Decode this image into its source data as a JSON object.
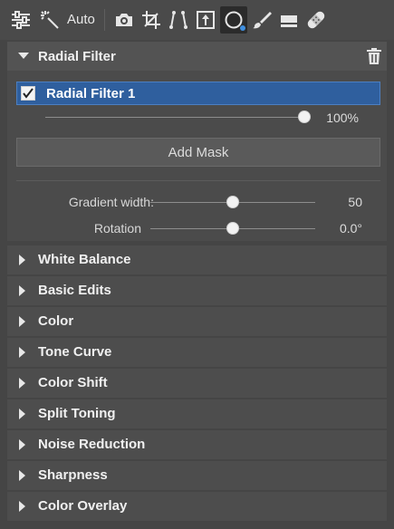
{
  "toolbar": {
    "auto_label": "Auto",
    "icons": [
      "sliders-icon",
      "magic-wand-icon",
      "camera-icon",
      "crop-icon",
      "perspective-icon",
      "export-icon",
      "radial-filter-icon",
      "brush-icon",
      "eraser-icon",
      "healing-bandage-icon"
    ],
    "active_tool": "radial-filter-icon",
    "active_dot_color": "#3f8fe0"
  },
  "radial_filter": {
    "title": "Radial Filter",
    "filters": [
      {
        "label": "Radial Filter 1",
        "checked": true,
        "opacity_label": "100%",
        "opacity": 1.0
      }
    ],
    "add_mask_label": "Add Mask",
    "gradient_width": {
      "label": "Gradient width:",
      "value_text": "50",
      "value": 50
    },
    "rotation": {
      "label": "Rotation",
      "value_text": "0.0°",
      "value": 0.0
    }
  },
  "sections": [
    {
      "title": "White Balance"
    },
    {
      "title": "Basic Edits"
    },
    {
      "title": "Color"
    },
    {
      "title": "Tone Curve"
    },
    {
      "title": "Color Shift"
    },
    {
      "title": "Split Toning"
    },
    {
      "title": "Noise Reduction"
    },
    {
      "title": "Sharpness"
    },
    {
      "title": "Color Overlay"
    }
  ],
  "colors": {
    "selected_item": "#2f5f9e",
    "background": "#454545"
  }
}
